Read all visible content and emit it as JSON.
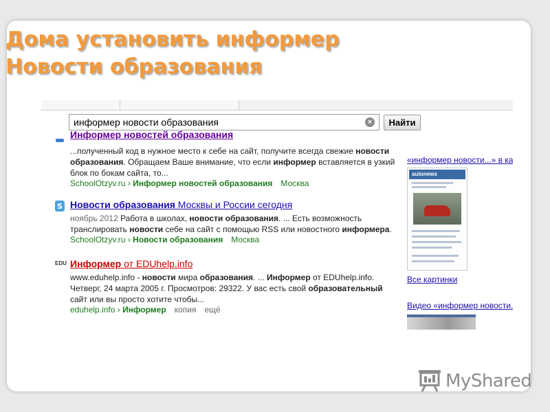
{
  "slide": {
    "title_line1": "Дома установить информер",
    "title_line2": "Новости образования"
  },
  "search": {
    "query": "информер новости образования",
    "button_label": "Найти",
    "clear_icon": "clear-icon"
  },
  "results": [
    {
      "title_bold": "Информер новостей образования",
      "title_rest": "",
      "snippet": "...полученный код в нужное место к себе на сайт, получите всегда свежие новости образования. Обращаем Ваше внимание, что если информер вставляется в узкий блок по бокам сайта, то...",
      "url_site": "SchoolOtzyv.ru",
      "url_sep": "›",
      "url_path": "Информер новостей образования",
      "url_extra": "Москва",
      "title_color": "#660099"
    },
    {
      "title_bold": "Новости образования",
      "title_rest": " Москвы и России сегодня",
      "snippet": "ноябрь 2012 Работа в школах, новости образования. ... Есть возможность транслировать новости себе на сайт с помощью RSS или новостного информера.",
      "url_site": "SchoolOtzyv.ru",
      "url_sep": "›",
      "url_path": "Новости образования",
      "url_extra": "Москва",
      "title_color": "#1a0dab"
    },
    {
      "title_bold": "Информер",
      "title_rest": " от EDUhelp.info",
      "snippet": "www.eduhelp.info - новости мира образования. ... Информер от EDUhelp.info. Четверг, 24 марта 2005 г. Просмотров: 29322. У вас есть свой образовательный сайт или вы просто хотите чтобы...",
      "url_site": "eduhelp.info",
      "url_sep": "›",
      "url_path": "Информер",
      "url_extra": "копия",
      "url_extra2": "ещё",
      "favicon_text": "EDU",
      "title_color": "#cc0000"
    }
  ],
  "sidebar": {
    "images_header": "«информер новости...» в картин",
    "all_images": "Все картинки",
    "video_header": "Видео «информер новости...»",
    "thumb_brand": "autonews"
  },
  "logo": {
    "text": "MyShared",
    "icon": "presentation-board-icon"
  },
  "colors": {
    "title": "#f39a3c",
    "url_green": "#1e7a1e",
    "link_blue": "#1a0dab"
  }
}
